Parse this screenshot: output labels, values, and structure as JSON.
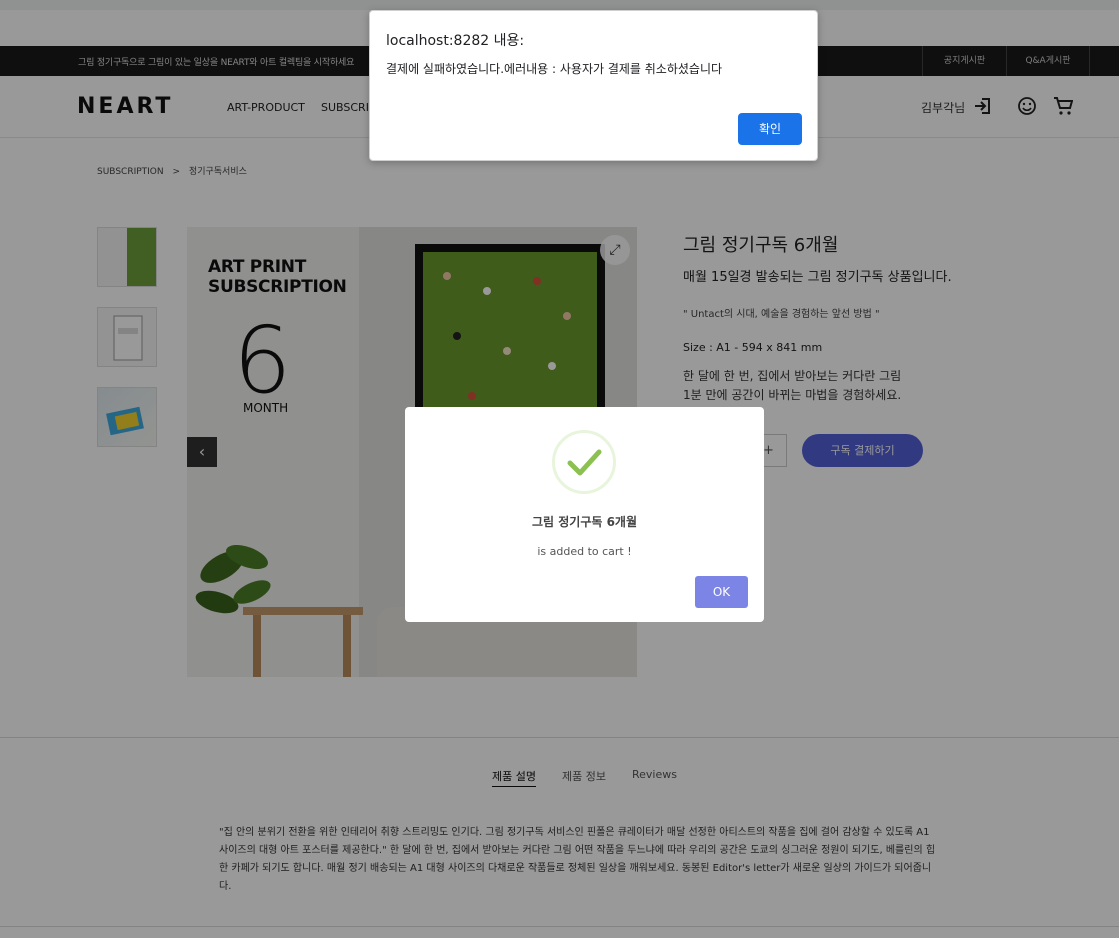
{
  "topbar": {
    "promo": "그림 정기구독으로 그림이 있는 일상을 NEART와 아트 컬렉팅을 시작하세요",
    "links": [
      "공지게시판",
      "Q&A게시판"
    ]
  },
  "header": {
    "logo": "NEART",
    "nav": [
      "ART-PRODUCT",
      "SUBSCRIPTION"
    ],
    "user_name": "김부각님"
  },
  "breadcrumb": [
    "SUBSCRIPTION",
    ">",
    "정기구독서비스"
  ],
  "product_image": {
    "art_title_line1": "ART PRINT",
    "art_title_line2": "SUBSCRIPTION",
    "number": "6",
    "unit": "MONTH"
  },
  "product": {
    "title": "그림 정기구독 6개월",
    "subtitle": "매월 15일경 발송되는 그림 정기구독 상품입니다.",
    "quote": "\" Untact의 시대, 예술을 경험하는 앞선 방법 \"",
    "size": "Size : A1 - 594 x 841 mm",
    "desc_line1": "한 달에 한 번, 집에서 받아보는 커다란 그림",
    "desc_line2": "1분 만에 공간이 바뀌는 마법을 경험하세요.",
    "qty_plus": "+",
    "buy_label": "구독 결제하기"
  },
  "tabs": [
    "제품 설명",
    "제품 정보",
    "Reviews"
  ],
  "description": "\"집 안의 분위기 전환을 위한 인테리어 취향 스트리밍도 인기다. 그림 정기구독 서비스인 핀폴은 큐레이터가 매달 선정한 아티스트의 작품을 집에 걸어 감상할 수 있도록 A1 사이즈의 대형 아트 포스터를 제공한다.\" 한 달에 한 번, 집에서 받아보는 커다란 그림 어떤 작품을 두느냐에 따라 우리의 공간은 도쿄의 싱그러운 정원이 되기도, 베를린의 힙한 카페가 되기도 합니다. 매월 정기 배송되는 A1 대형 사이즈의 다채로운 작품들로 정체된 일상을 깨워보세요. 동봉된 Editor's letter가 새로운 일상의 가이드가 되어줍니다.",
  "cart_modal": {
    "title": "그림 정기구독 6개월",
    "text": "is added to cart !",
    "ok_label": "OK"
  },
  "browser_alert": {
    "title": "localhost:8282 내용:",
    "message": "결제에 실패하였습니다.에러내용 : 사용자가 결제를 취소하셨습니다",
    "confirm_label": "확인"
  },
  "colors": {
    "buy_button": "#5260d5",
    "ok_button": "#7c85e5",
    "alert_button": "#1a73e8",
    "check": "#8cc152"
  }
}
